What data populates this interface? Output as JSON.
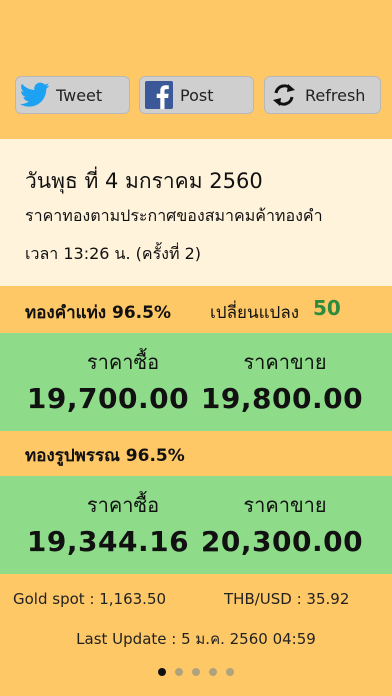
{
  "toolbar": {
    "tweet_label": "Tweet",
    "post_label": "Post",
    "refresh_label": "Refresh"
  },
  "header": {
    "date": "วันพุธ ที่ 4 มกราคม 2560",
    "announcement": "ราคาทองตามประกาศของสมาคมค้าทองคำ",
    "time": "เวลา 13:26 น. (ครั้งที่ 2)"
  },
  "bar_gold": {
    "title": "ทองคำแท่ง 96.5%",
    "change_label": "เปลี่ยนแปลง",
    "change_value": "50",
    "buy_label": "ราคาซื้อ",
    "sell_label": "ราคาขาย",
    "buy_price": "19,700.00",
    "sell_price": "19,800.00"
  },
  "ornament_gold": {
    "title": "ทองรูปพรรณ 96.5%",
    "buy_label": "ราคาซื้อ",
    "sell_label": "ราคาขาย",
    "buy_price": "19,344.16",
    "sell_price": "20,300.00"
  },
  "footer": {
    "gold_spot": "Gold spot : 1,163.50",
    "thb_usd": "THB/USD : 35.92",
    "last_update": "Last Update : 5 ม.ค. 2560 04:59"
  },
  "pager": {
    "count": 5,
    "active": 0
  },
  "colors": {
    "background": "#FFC867",
    "panel": "#FFF3DC",
    "price_block": "#8EDC8A",
    "change_positive": "#2E8B3E",
    "twitter": "#1DA1F2",
    "facebook": "#3B5998"
  }
}
